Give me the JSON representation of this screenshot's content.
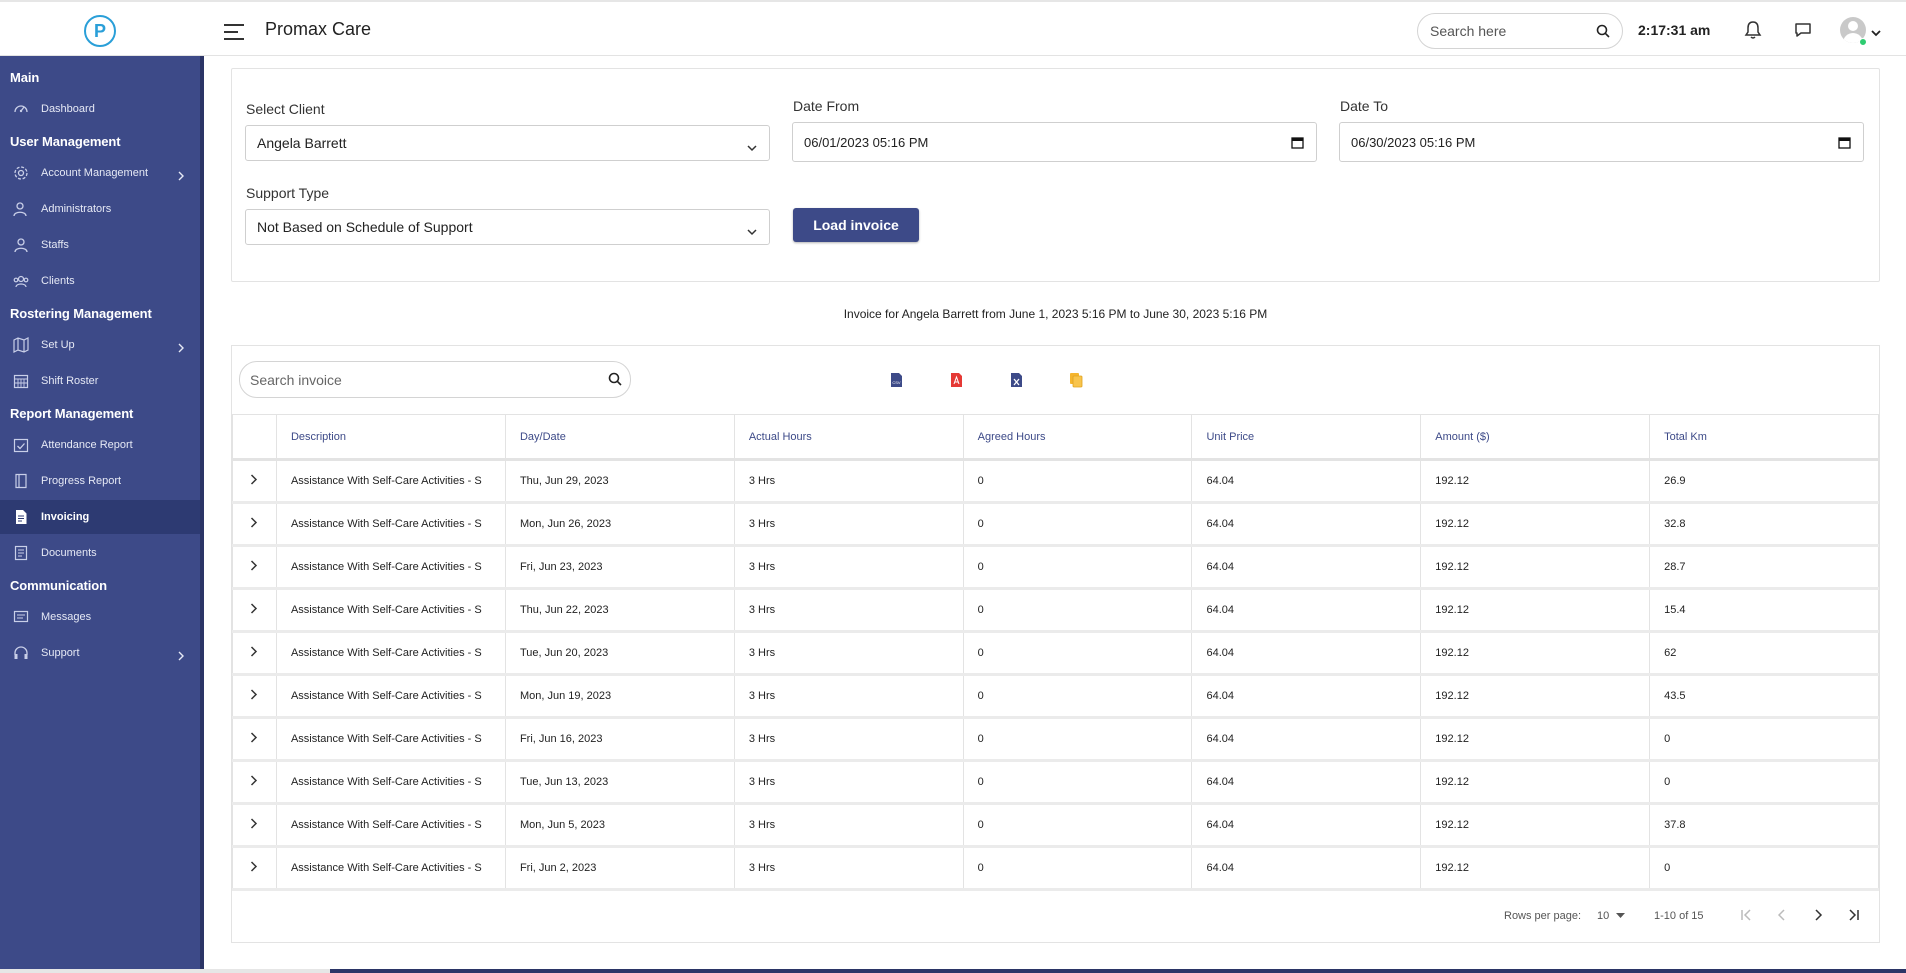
{
  "app": {
    "title": "Promax Care",
    "logo_letter": "P"
  },
  "header": {
    "search_placeholder": "Search here",
    "time": "2:17:31 am"
  },
  "sidebar": {
    "sections": [
      {
        "label": "Main"
      },
      {
        "label": "User Management"
      },
      {
        "label": "Rostering Management"
      },
      {
        "label": "Report Management"
      },
      {
        "label": "Communication"
      }
    ],
    "items": [
      {
        "label": "Dashboard",
        "icon": "dashboard-icon"
      },
      {
        "label": "Account Management",
        "icon": "gear-icon",
        "has_submenu": true
      },
      {
        "label": "Administrators",
        "icon": "admin-user-icon"
      },
      {
        "label": "Staffs",
        "icon": "user-icon"
      },
      {
        "label": "Clients",
        "icon": "clients-icon"
      },
      {
        "label": "Set Up",
        "icon": "map-icon",
        "has_submenu": true
      },
      {
        "label": "Shift Roster",
        "icon": "calendar-icon"
      },
      {
        "label": "Attendance Report",
        "icon": "check-calendar-icon"
      },
      {
        "label": "Progress Report",
        "icon": "book-icon"
      },
      {
        "label": "Invoicing",
        "icon": "document-icon",
        "active": true
      },
      {
        "label": "Documents",
        "icon": "documents-icon"
      },
      {
        "label": "Messages",
        "icon": "message-icon"
      },
      {
        "label": "Support",
        "icon": "headset-icon",
        "has_submenu": true
      }
    ]
  },
  "filters": {
    "client_label": "Select Client",
    "client_value": "Angela Barrett",
    "date_from_label": "Date From",
    "date_from_value": "06/01/2023 05:16  PM",
    "date_to_label": "Date To",
    "date_to_value": "06/30/2023 05:16  PM",
    "support_type_label": "Support Type",
    "support_type_value": "Not Based on Schedule of Support",
    "load_button": "Load invoice"
  },
  "invoice_caption": "Invoice for Angela Barrett from June 1, 2023 5:16 PM to June 30, 2023 5:16 PM",
  "table": {
    "search_placeholder": "Search invoice",
    "export_icons": [
      {
        "name": "csv-export-icon",
        "color": "#3d4a88"
      },
      {
        "name": "pdf-export-icon",
        "color": "#e53935"
      },
      {
        "name": "excel-export-icon",
        "color": "#3d4a88"
      },
      {
        "name": "copy-icon",
        "color": "#f5b52e"
      }
    ],
    "columns": [
      "Description",
      "Day/Date",
      "Actual Hours",
      "Agreed Hours",
      "Unit Price",
      "Amount ($)",
      "Total Km"
    ],
    "rows": [
      [
        "Assistance With Self-Care Activities - S",
        "Thu, Jun 29, 2023",
        "3 Hrs",
        "0",
        "64.04",
        "192.12",
        "26.9"
      ],
      [
        "Assistance With Self-Care Activities - S",
        "Mon, Jun 26, 2023",
        "3 Hrs",
        "0",
        "64.04",
        "192.12",
        "32.8"
      ],
      [
        "Assistance With Self-Care Activities - S",
        "Fri, Jun 23, 2023",
        "3 Hrs",
        "0",
        "64.04",
        "192.12",
        "28.7"
      ],
      [
        "Assistance With Self-Care Activities - S",
        "Thu, Jun 22, 2023",
        "3 Hrs",
        "0",
        "64.04",
        "192.12",
        "15.4"
      ],
      [
        "Assistance With Self-Care Activities - S",
        "Tue, Jun 20, 2023",
        "3 Hrs",
        "0",
        "64.04",
        "192.12",
        "62"
      ],
      [
        "Assistance With Self-Care Activities - S",
        "Mon, Jun 19, 2023",
        "3 Hrs",
        "0",
        "64.04",
        "192.12",
        "43.5"
      ],
      [
        "Assistance With Self-Care Activities - S",
        "Fri, Jun 16, 2023",
        "3 Hrs",
        "0",
        "64.04",
        "192.12",
        "0"
      ],
      [
        "Assistance With Self-Care Activities - S",
        "Tue, Jun 13, 2023",
        "3 Hrs",
        "0",
        "64.04",
        "192.12",
        "0"
      ],
      [
        "Assistance With Self-Care Activities - S",
        "Mon, Jun 5, 2023",
        "3 Hrs",
        "0",
        "64.04",
        "192.12",
        "37.8"
      ],
      [
        "Assistance With Self-Care Activities - S",
        "Fri, Jun 2, 2023",
        "3 Hrs",
        "0",
        "64.04",
        "192.12",
        "0"
      ]
    ]
  },
  "pagination": {
    "rows_per_page_label": "Rows per page:",
    "rows_per_page": "10",
    "range": "1-10 of 15"
  },
  "colors": {
    "sidebar": "#3d4a88",
    "sidebar_active": "#2d3a72",
    "accent": "#3d4a88",
    "logo": "#2a9fd8"
  }
}
